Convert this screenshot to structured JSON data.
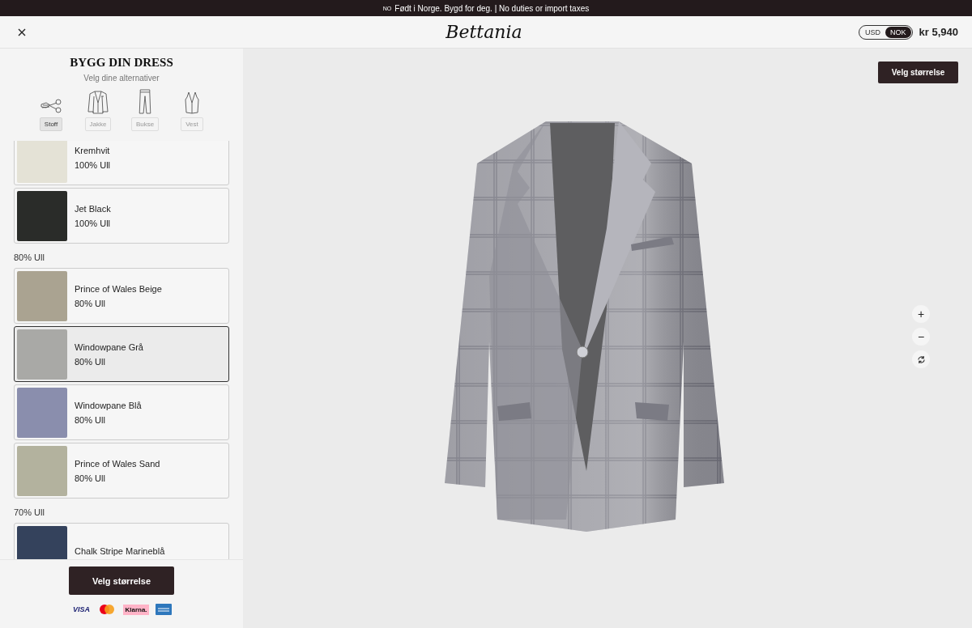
{
  "announcement": {
    "country": "NO",
    "text": "Født i Norge. Bygd for deg. | No duties or import taxes"
  },
  "header": {
    "logo": "Bettania",
    "currencies": [
      {
        "label": "USD",
        "selected": false
      },
      {
        "label": "NOK",
        "selected": true
      }
    ],
    "price": "kr 5,940"
  },
  "sidebar": {
    "title": "BYGG DIN DRESS",
    "subtitle": "Velg dine alternativer",
    "steps": [
      {
        "kind": "fabric",
        "label": "Stoff",
        "selected": true
      },
      {
        "kind": "jacket",
        "label": "Jakke",
        "selected": false
      },
      {
        "kind": "trousers",
        "label": "Bukse",
        "selected": false
      },
      {
        "kind": "vest",
        "label": "Vest",
        "selected": false
      }
    ],
    "fabric_groups": [
      {
        "items": [
          {
            "name": "Kremhvit",
            "material": "100% Ull",
            "color": "#e4e2d6",
            "selected": false
          },
          {
            "name": "Jet Black",
            "material": "100% Ull",
            "color": "#2a2c29",
            "selected": false
          }
        ]
      },
      {
        "heading": "80% Ull",
        "items": [
          {
            "name": "Prince of Wales Beige",
            "material": "80% Ull",
            "color": "#aaa391",
            "selected": false
          },
          {
            "name": "Windowpane Grå",
            "material": "80% Ull",
            "color": "#a9a9a6",
            "selected": true
          },
          {
            "name": "Windowpane Blå",
            "material": "80% Ull",
            "color": "#8a8ead",
            "selected": false
          },
          {
            "name": "Prince of Wales Sand",
            "material": "80% Ull",
            "color": "#b3b29e",
            "selected": false
          }
        ]
      },
      {
        "heading": "70% Ull",
        "items": [
          {
            "name": "Chalk Stripe Marineblå",
            "color": "#34425c",
            "selected": false
          }
        ]
      }
    ],
    "footer_button": "Velg størrelse",
    "payment_methods": [
      {
        "kind": "visa",
        "label": "VISA"
      },
      {
        "kind": "mastercard"
      },
      {
        "kind": "klarna",
        "label": "Klarna."
      },
      {
        "kind": "amex"
      }
    ]
  },
  "preview": {
    "size_button": "Velg størrelse",
    "controls": [
      {
        "kind": "zoom-in",
        "symbol": "+"
      },
      {
        "kind": "zoom-out",
        "symbol": "−"
      },
      {
        "kind": "rotate"
      }
    ]
  }
}
